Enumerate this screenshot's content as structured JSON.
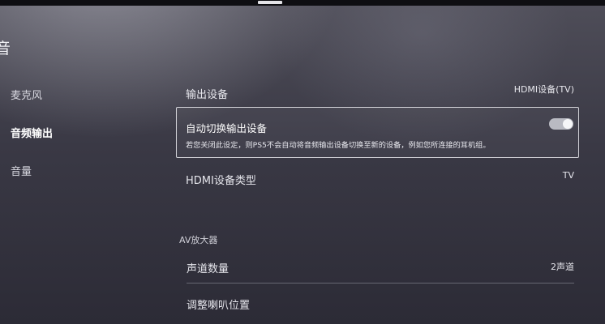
{
  "header": {
    "title_fragment": "音"
  },
  "sidebar": {
    "items": [
      {
        "label": "麦克风",
        "active": false
      },
      {
        "label": "音频输出",
        "active": true
      },
      {
        "label": "音量",
        "active": false
      }
    ]
  },
  "settings": {
    "output_device": {
      "label": "输出设备",
      "value": "HDMI设备(TV)"
    },
    "auto_switch": {
      "label": "自动切换输出设备",
      "description": "若您关闭此设定，则PS5不会自动将音频输出设备切换至新的设备，例如您所连接的耳机组。",
      "enabled": true
    },
    "hdmi_type": {
      "label": "HDMI设备类型",
      "value": "TV"
    }
  },
  "av_amp": {
    "section_title": "AV放大器",
    "channels": {
      "label": "声道数量",
      "value": "2声道"
    },
    "speaker_position": {
      "label": "调整喇叭位置"
    }
  },
  "colors": {
    "toggle_on": "#b9bac2",
    "focus_border": "#ebebf0"
  }
}
